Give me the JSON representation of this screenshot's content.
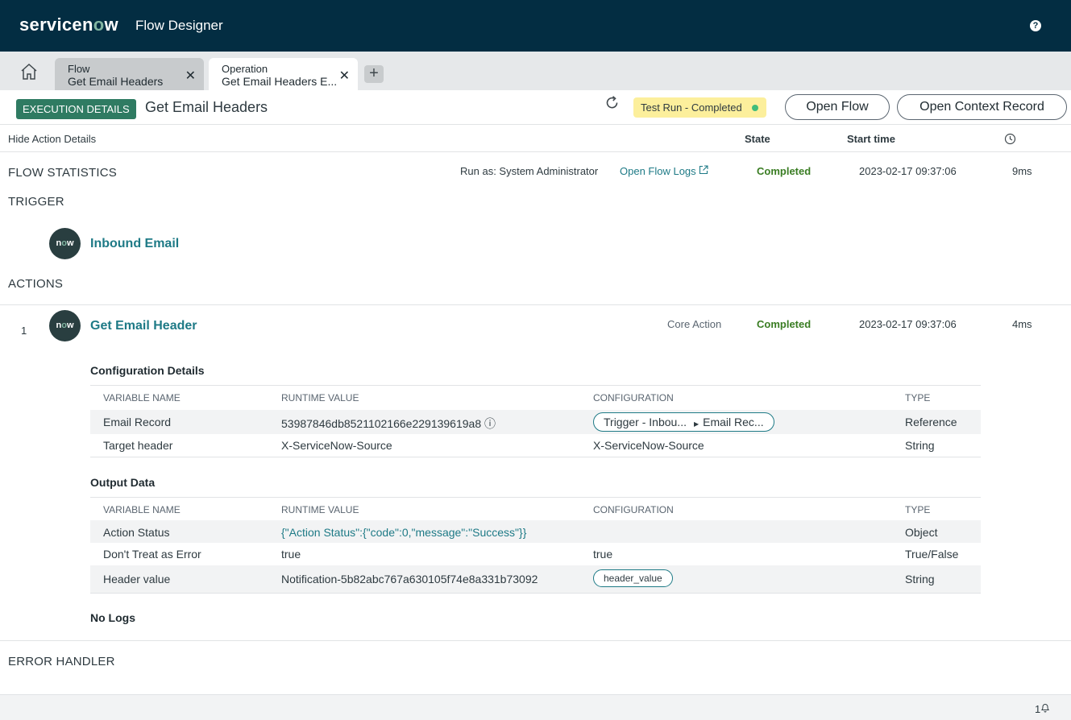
{
  "banner": {
    "logo_text_a": "servicen",
    "logo_text_o": "o",
    "logo_text_b": "w",
    "app_name": "Flow Designer",
    "help_icon": "question-icon"
  },
  "tabs": [
    {
      "type": "Flow",
      "name": "Get Email Headers"
    },
    {
      "type": "Operation",
      "name": "Get Email Headers E..."
    }
  ],
  "header": {
    "badge": "EXECUTION DETAILS",
    "title": "Get Email Headers",
    "status": "Test Run - Completed",
    "open_flow": "Open Flow",
    "open_context": "Open Context Record"
  },
  "columns": {
    "hide_details": "Hide Action Details",
    "state": "State",
    "start_time": "Start time"
  },
  "flow_statistics": {
    "title": "FLOW STATISTICS",
    "run_as": "Run as: System Administrator",
    "open_logs": "Open Flow Logs",
    "state": "Completed",
    "start_time": "2023-02-17 09:37:06",
    "duration": "9ms"
  },
  "trigger": {
    "title": "TRIGGER",
    "name": "Inbound Email",
    "logo": "now"
  },
  "actions": {
    "title": "ACTIONS",
    "items": [
      {
        "number": "1",
        "name": "Get Email Header",
        "kind": "Core Action",
        "state": "Completed",
        "start_time": "2023-02-17 09:37:06",
        "duration": "4ms",
        "config_title": "Configuration Details",
        "output_title": "Output Data",
        "headers": [
          "VARIABLE NAME",
          "RUNTIME VALUE",
          "CONFIGURATION",
          "TYPE"
        ],
        "config_rows": [
          {
            "name": "Email Record",
            "value": "53987846db8521102166e229139619a8",
            "config_a": "Trigger - Inbou...",
            "config_b": "Email Rec...",
            "type": "Reference"
          },
          {
            "name": "Target header",
            "value": "X-ServiceNow-Source",
            "config": "X-ServiceNow-Source",
            "type": "String"
          }
        ],
        "output_rows": [
          {
            "name": "Action Status",
            "value": "{\"Action Status\":{\"code\":0,\"message\":\"Success\"}}",
            "config": "",
            "type": "Object"
          },
          {
            "name": "Don't Treat as Error",
            "value": "true",
            "config": "true",
            "type": "True/False"
          },
          {
            "name": "Header value",
            "value": "Notification-5b82abc767a630105f74e8a331b73092",
            "config": "header_value",
            "type": "String"
          }
        ],
        "logs": "No Logs"
      }
    ]
  },
  "error_handler": {
    "title": "ERROR HANDLER"
  },
  "footer": {
    "count": "1"
  },
  "colors": {
    "banner": "#032d42",
    "accent_teal": "#1e7a86",
    "badge_green": "#2f7b62",
    "status_yellow": "#fcef9c",
    "completed_green": "#3a7d23"
  }
}
